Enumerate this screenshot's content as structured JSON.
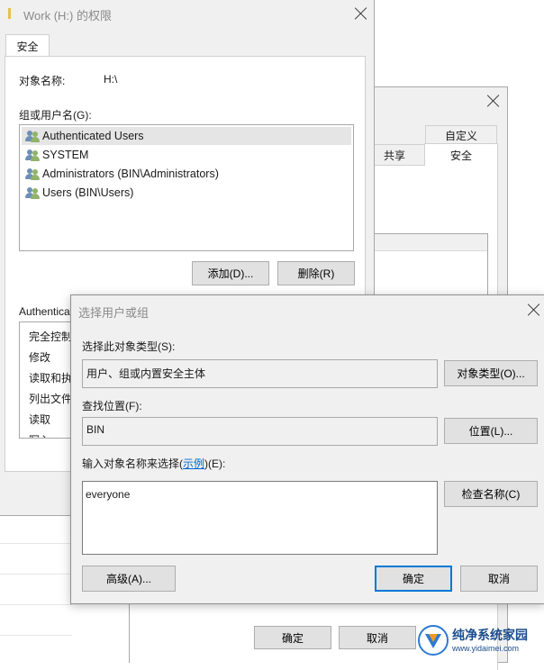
{
  "perm_window": {
    "title": "Work (H:) 的权限",
    "tab_security": "安全",
    "object_name_label": "对象名称:",
    "object_name_value": "H:\\",
    "group_label": "组或用户名(G):",
    "users": [
      "Authenticated Users",
      "SYSTEM",
      "Administrators (BIN\\Administrators)",
      "Users (BIN\\Users)"
    ],
    "add_button": "添加(D)...",
    "remove_button": "删除(R)",
    "permissions_header_partial": "Authentica",
    "permissions": [
      "完全控制",
      "修改",
      "读取和执",
      "列出文件",
      "读取",
      "写入"
    ]
  },
  "props_window": {
    "tab_custom": "自定义",
    "tab_share": "共享",
    "tab_security": "安全",
    "ok_button": "确定",
    "cancel_button": "取消"
  },
  "select_dialog": {
    "title": "选择用户或组",
    "object_type_label": "选择此对象类型(S):",
    "object_type_value": "用户、组或内置安全主体",
    "object_type_button": "对象类型(O)...",
    "location_label": "查找位置(F):",
    "location_value": "BIN",
    "location_button": "位置(L)...",
    "enter_names_prefix": "输入对象名称来选择(",
    "enter_names_link": "示例",
    "enter_names_suffix": ")(E):",
    "names_input": "everyone",
    "check_names_button": "检查名称(C)",
    "advanced_button": "高级(A)...",
    "ok_button": "确定",
    "cancel_button": "取消"
  },
  "watermark": {
    "site_name": "纯净系统家园",
    "site_url": "www.yidaimei.com"
  }
}
